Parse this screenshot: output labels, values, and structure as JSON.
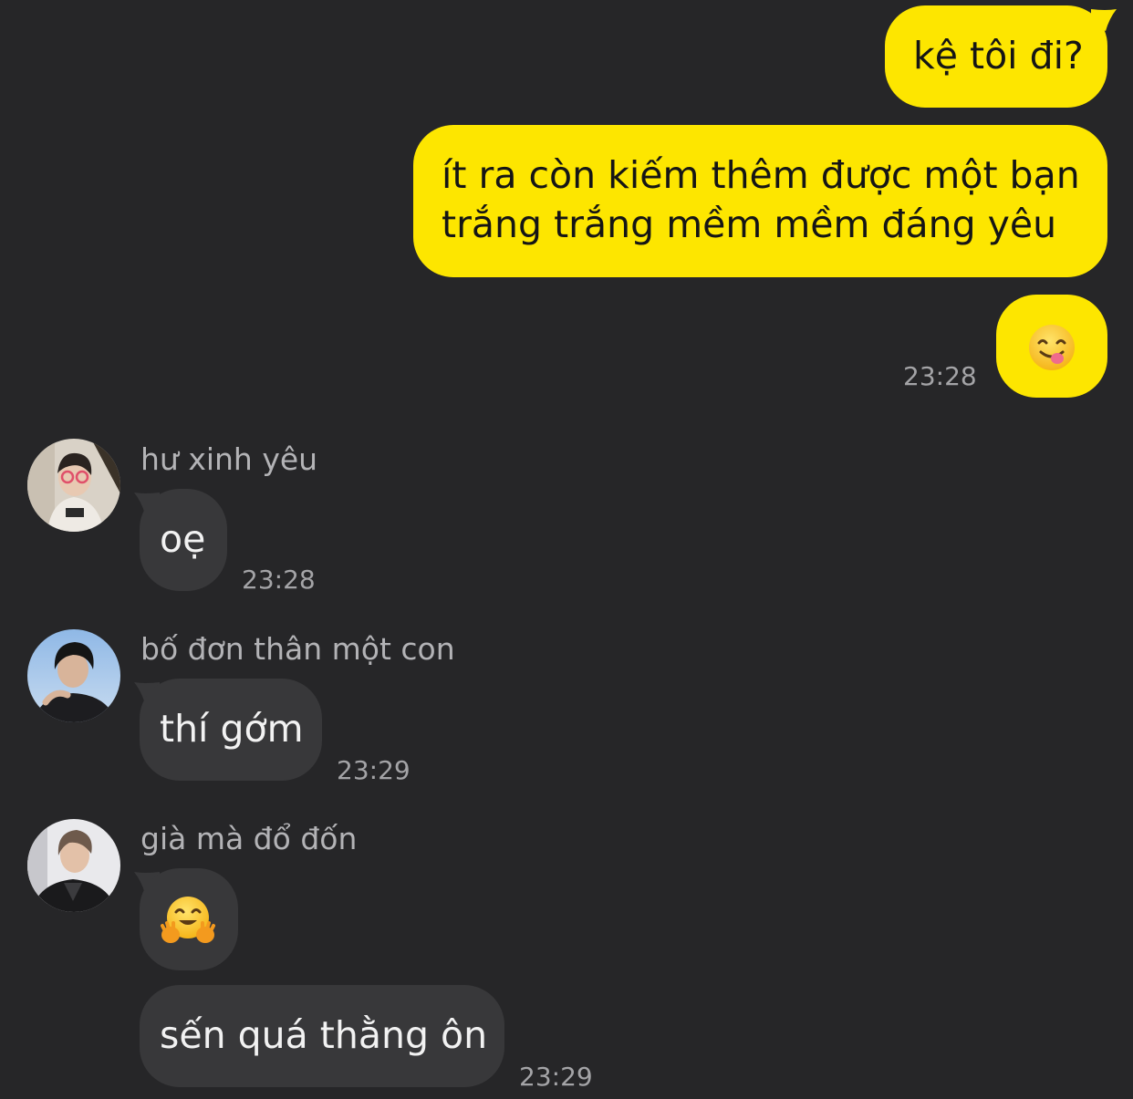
{
  "outgoing": [
    {
      "text": "kệ tôi đi?"
    },
    {
      "lines": [
        "ít ra còn kiếm thêm được một bạn",
        "trắng trắng mềm mềm đáng yêu"
      ]
    },
    {
      "emoji": "savoring-food-emoji",
      "time": "23:28"
    }
  ],
  "incoming": [
    {
      "sender": "hư xinh yêu",
      "messages": [
        "oẹ"
      ],
      "time": "23:28"
    },
    {
      "sender": "bố đơn thân một con",
      "messages": [
        "thí gớm"
      ],
      "time": "23:29"
    },
    {
      "sender": "già mà đổ đốn",
      "emoji": "hugging-face-emoji",
      "messages": [
        "sến quá thằng ôn"
      ],
      "time": "23:29"
    }
  ],
  "colors": {
    "background": "#262628",
    "outgoing_bubble": "#fde600",
    "incoming_bubble": "#38383a",
    "timestamp": "#a4a4a7",
    "sender_name": "#b3b3b6"
  }
}
